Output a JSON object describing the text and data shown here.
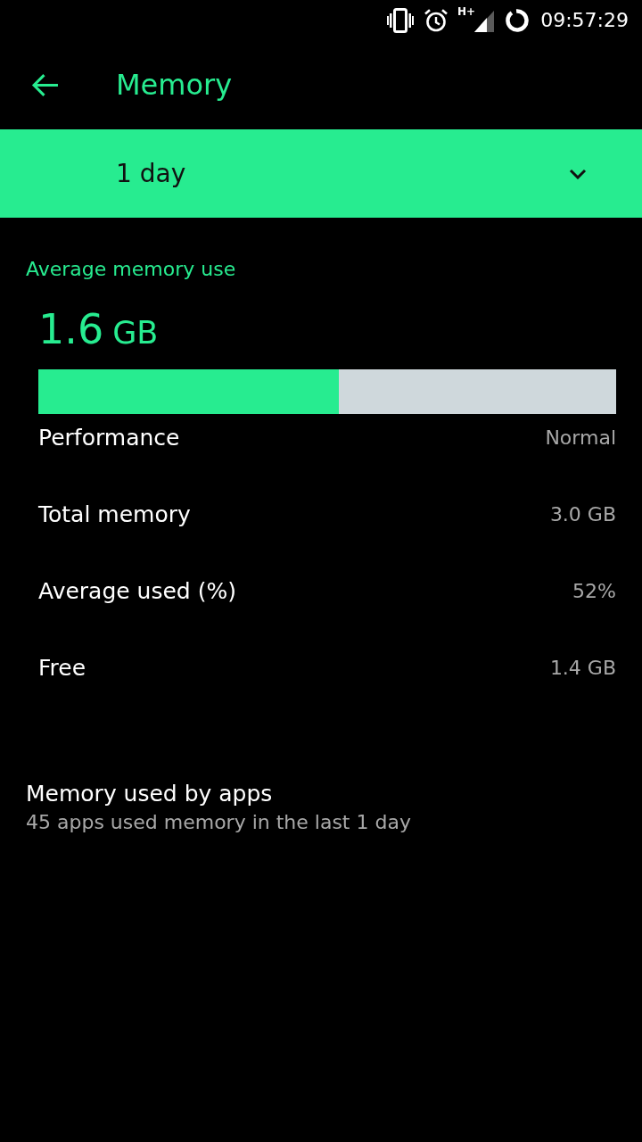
{
  "status_bar": {
    "network_label": "H+",
    "time": "09:57:29"
  },
  "app_bar": {
    "title": "Memory"
  },
  "period_dropdown": {
    "value": "1 day"
  },
  "average_memory": {
    "label": "Average memory use",
    "value": "1.6",
    "unit": "GB",
    "level": 0.52
  },
  "stats": [
    {
      "label": "Performance",
      "value": "Normal"
    },
    {
      "label": "Total memory",
      "value": "3.0 GB"
    },
    {
      "label": "Average used (%)",
      "value": "52%"
    },
    {
      "label": "Free",
      "value": "1.4 GB"
    }
  ],
  "apps_section": {
    "title": "Memory used by apps",
    "subtitle": "45 apps used memory in the last 1 day"
  }
}
